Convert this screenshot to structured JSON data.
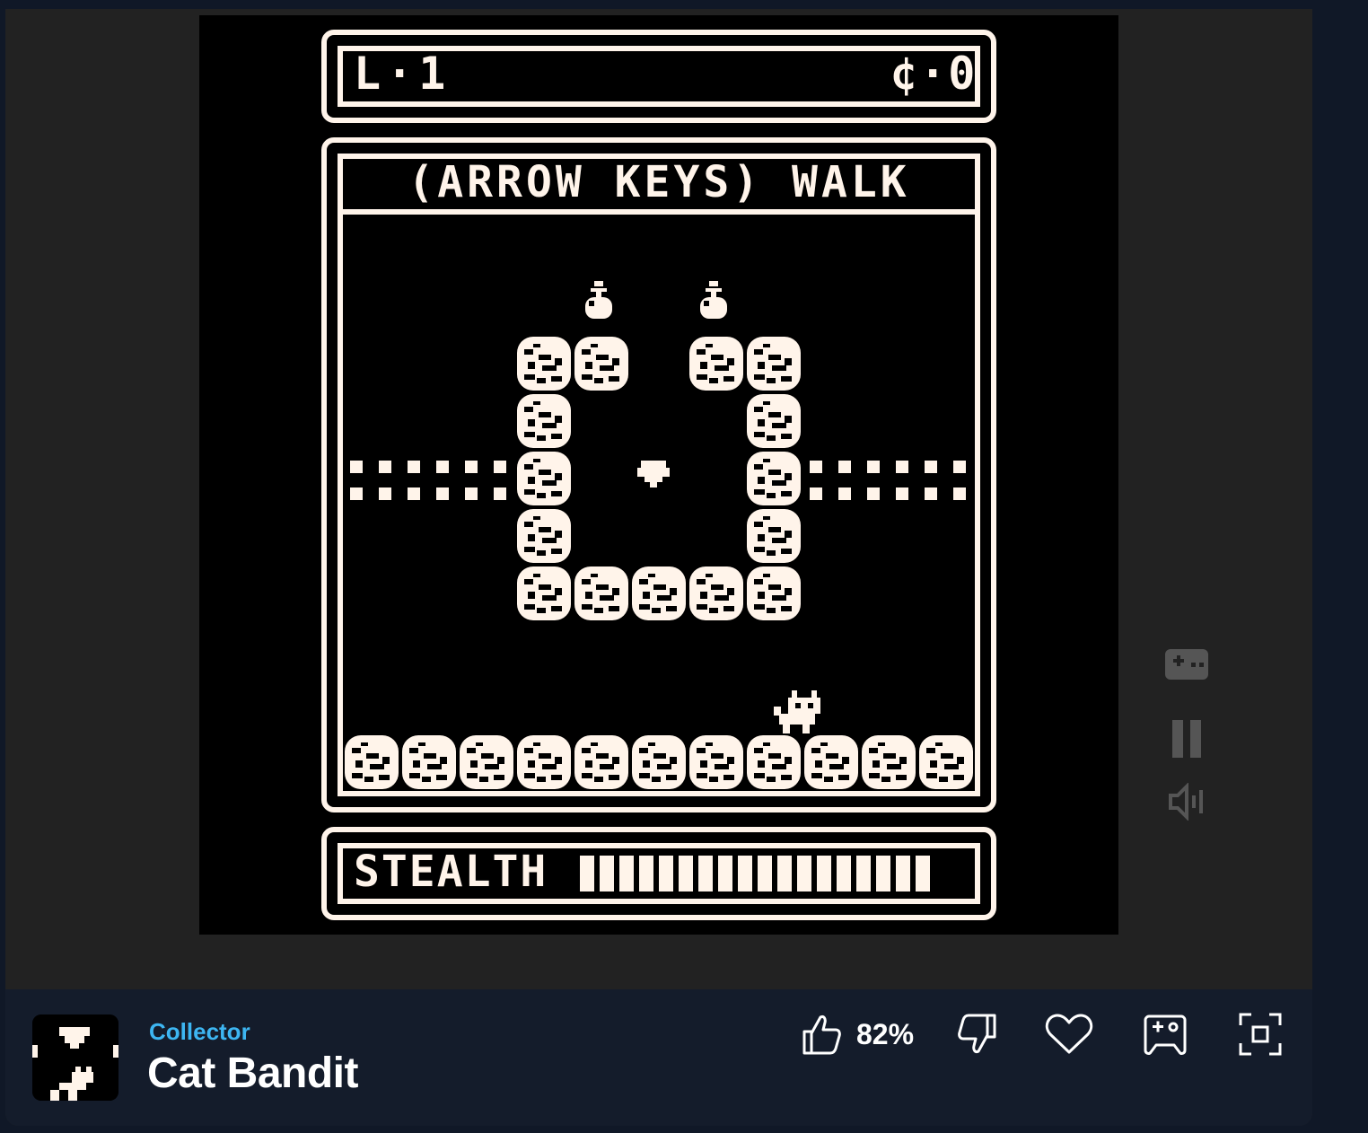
{
  "game": {
    "level_label": "L·1",
    "coins_label": "¢·0",
    "instruction": "(ARROW KEYS) WALK",
    "stealth_label": "STEALTH",
    "stealth_level": 1.0
  },
  "controls": {
    "gamepad_icon": "gamepad-icon",
    "pause_icon": "pause-icon",
    "sound_icon": "sound-icon"
  },
  "info": {
    "author": "Collector",
    "title": "Cat Bandit",
    "rating": "82%"
  },
  "colors": {
    "screen_bg": "#000000",
    "pixel": "#fff4ea",
    "page_bg": "#222222",
    "bar_bg": "#141c2b",
    "author": "#3db6f2"
  }
}
